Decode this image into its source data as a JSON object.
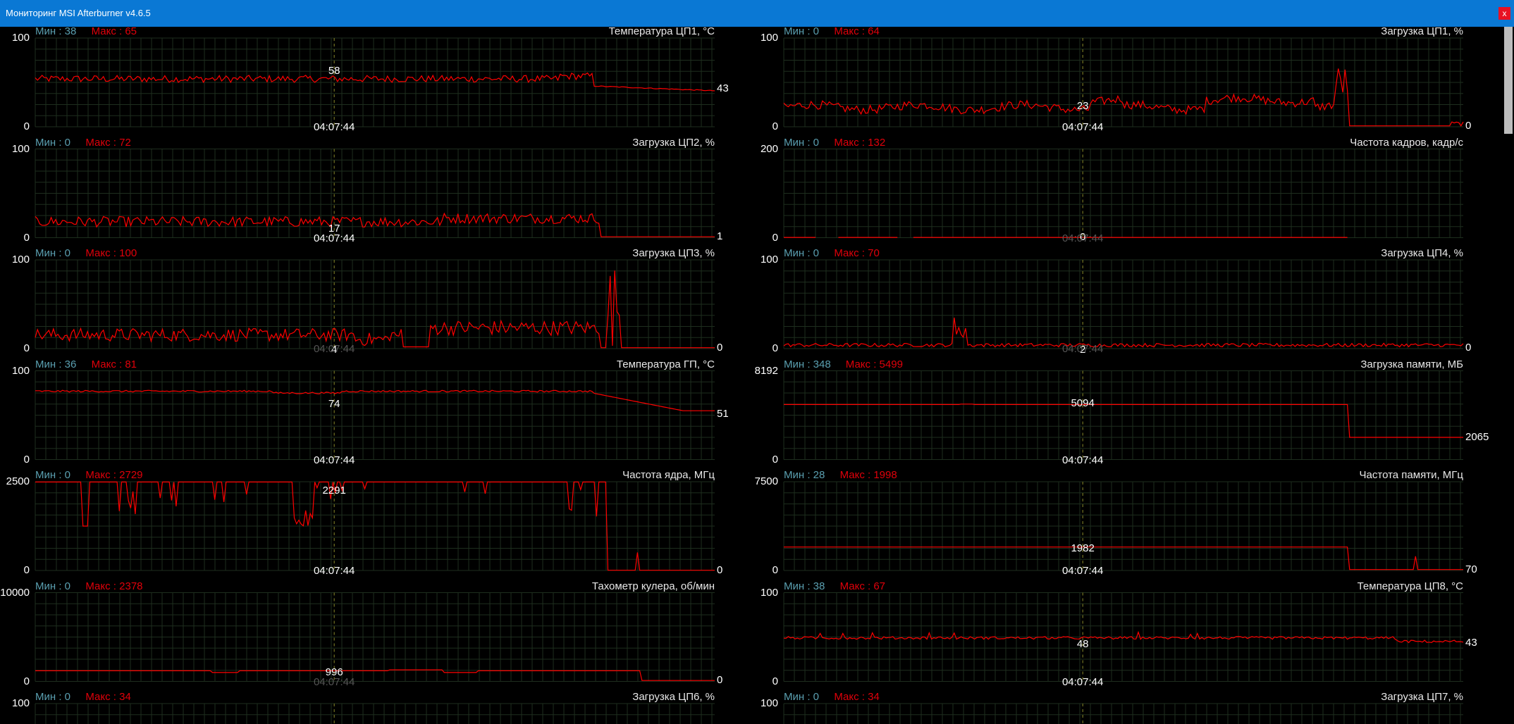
{
  "window": {
    "title": "Мониторинг MSI Afterburner v4.6.5",
    "close_label": "x"
  },
  "colors": {
    "titlebar": "#0a78d4",
    "line": "#ff0000",
    "grid": "#1e2e1e",
    "min": "#5a9fb0",
    "max": "#e0000a",
    "cursor": "#8a8a2a"
  },
  "panels": [
    {
      "title": "Температура ЦП1, °C",
      "min_text": "Мин : 38",
      "max_text": "Макс : 65",
      "ymax": "100",
      "ymin": "0",
      "ymax_num": 100,
      "center_value": "58",
      "current": "43",
      "time": "04:07:44",
      "time_dim": false,
      "center_dim": false,
      "profile": "cpu1temp"
    },
    {
      "title": "Загрузка ЦП1, %",
      "min_text": "Мин : 0",
      "max_text": "Макс : 64",
      "ymax": "100",
      "ymin": "0",
      "ymax_num": 100,
      "center_value": "23",
      "current": "0",
      "time": "04:07:44",
      "time_dim": false,
      "center_dim": false,
      "profile": "cpu1load"
    },
    {
      "title": "Загрузка ЦП2, %",
      "min_text": "Мин : 0",
      "max_text": "Макс : 72",
      "ymax": "100",
      "ymin": "0",
      "ymax_num": 100,
      "center_value": "17",
      "current": "1",
      "time": "04:07:44",
      "time_dim": false,
      "center_dim": false,
      "profile": "cpu2load"
    },
    {
      "title": "Частота кадров, кадр/с",
      "min_text": "Мин : 0",
      "max_text": "Макс : 132",
      "ymax": "200",
      "ymin": "0",
      "ymax_num": 200,
      "center_value": "0",
      "current": "",
      "time": "04:07:44",
      "time_dim": true,
      "center_dim": false,
      "profile": "fps"
    },
    {
      "title": "Загрузка ЦП3, %",
      "min_text": "Мин : 0",
      "max_text": "Макс : 100",
      "ymax": "100",
      "ymin": "0",
      "ymax_num": 100,
      "center_value": "4",
      "current": "0",
      "time": "04:07:44",
      "time_dim": true,
      "center_dim": false,
      "profile": "cpu3load"
    },
    {
      "title": "Загрузка ЦП4, %",
      "min_text": "Мин : 0",
      "max_text": "Макс : 70",
      "ymax": "100",
      "ymin": "0",
      "ymax_num": 100,
      "center_value": "2",
      "current": "0",
      "time": "04:07:44",
      "time_dim": true,
      "center_dim": false,
      "profile": "cpu4load"
    },
    {
      "title": "Температура ГП, °C",
      "min_text": "Мин : 36",
      "max_text": "Макс : 81",
      "ymax": "100",
      "ymin": "0",
      "ymax_num": 100,
      "center_value": "74",
      "current": "51",
      "time": "04:07:44",
      "time_dim": false,
      "center_dim": false,
      "profile": "gputemp"
    },
    {
      "title": "Загрузка памяти, МБ",
      "min_text": "Мин : 348",
      "max_text": "Макс : 5499",
      "ymax": "8192",
      "ymin": "0",
      "ymax_num": 8192,
      "center_value": "5094",
      "current": "2065",
      "time": "04:07:44",
      "time_dim": false,
      "center_dim": false,
      "profile": "memload"
    },
    {
      "title": "Частота ядра, МГц",
      "min_text": "Мин : 0",
      "max_text": "Макс : 2729",
      "ymax": "2500",
      "ymin": "0",
      "ymax_num": 2500,
      "center_value": "2291",
      "current": "0",
      "time": "04:07:44",
      "time_dim": false,
      "center_dim": false,
      "profile": "coreclock"
    },
    {
      "title": "Частота памяти, МГц",
      "min_text": "Мин : 28",
      "max_text": "Макс : 1998",
      "ymax": "7500",
      "ymin": "0",
      "ymax_num": 7500,
      "center_value": "1982",
      "current": "70",
      "time": "04:07:44",
      "time_dim": false,
      "center_dim": false,
      "profile": "memclock"
    },
    {
      "title": "Тахометр кулера, об/мин",
      "min_text": "Мин : 0",
      "max_text": "Макс : 2378",
      "ymax": "10000",
      "ymin": "0",
      "ymax_num": 10000,
      "center_value": "996",
      "current": "0",
      "time": "04:07:44",
      "time_dim": true,
      "center_dim": false,
      "profile": "fan"
    },
    {
      "title": "Температура ЦП8, °C",
      "min_text": "Мин : 38",
      "max_text": "Макс : 67",
      "ymax": "100",
      "ymin": "0",
      "ymax_num": 100,
      "center_value": "48",
      "current": "43",
      "time": "04:07:44",
      "time_dim": false,
      "center_dim": false,
      "profile": "cpu8temp"
    },
    {
      "title": "Загрузка ЦП6, %",
      "min_text": "Мин : 0",
      "max_text": "Макс : 34",
      "ymax": "100",
      "ymin": "",
      "ymax_num": 100,
      "center_value": "",
      "current": "",
      "time": "",
      "time_dim": false,
      "center_dim": false,
      "profile": "none"
    },
    {
      "title": "Загрузка ЦП7, %",
      "min_text": "Мин : 0",
      "max_text": "Макс : 34",
      "ymax": "100",
      "ymin": "",
      "ymax_num": 100,
      "center_value": "",
      "current": "",
      "time": "",
      "time_dim": false,
      "center_dim": false,
      "profile": "none"
    }
  ]
}
